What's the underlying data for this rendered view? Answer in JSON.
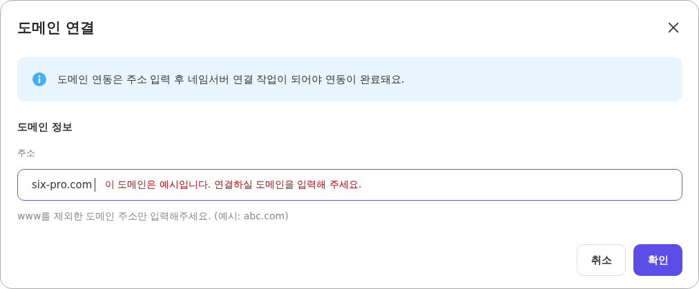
{
  "dialog": {
    "title": "도메인 연결"
  },
  "notice": {
    "text": "도메인 연동은 주소 입력 후 네임서버 연결 작업이 되어야 연동이 완료돼요."
  },
  "section": {
    "title": "도메인 정보"
  },
  "address": {
    "label": "주소",
    "value": "six-pro.com",
    "error": "이 도메인은 예시입니다. 연결하실 도메인을 입력해 주세요.",
    "hint": "www를 제외한 도메인 주소만 입력해주세요. (예시: abc.com)"
  },
  "buttons": [
    {
      "label": "취소",
      "kind": "secondary"
    },
    {
      "label": "확인",
      "kind": "primary"
    }
  ]
}
